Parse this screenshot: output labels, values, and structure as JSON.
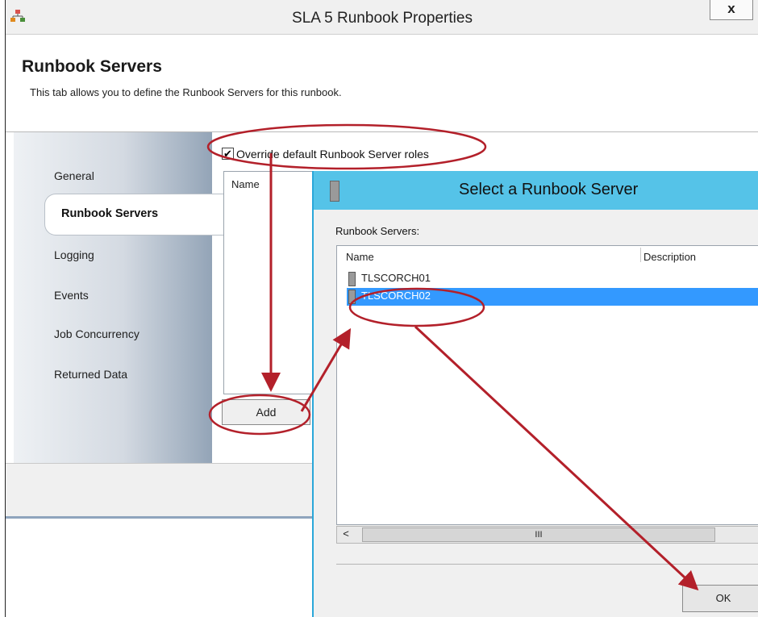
{
  "window": {
    "title": "SLA 5 Runbook Properties",
    "close_label": "x",
    "app_icon": "org-chart-icon"
  },
  "header": {
    "title": "Runbook Servers",
    "subtitle": "This tab allows you to define the Runbook Servers for this runbook."
  },
  "sidebar": {
    "items": [
      {
        "label": "General"
      },
      {
        "label": "Runbook Servers",
        "active": true
      },
      {
        "label": "Logging"
      },
      {
        "label": "Events"
      },
      {
        "label": "Job Concurrency"
      },
      {
        "label": "Returned Data"
      }
    ]
  },
  "main": {
    "override_checkbox": {
      "label": "Override default Runbook Server roles",
      "checked": true,
      "check_glyph": "✔"
    },
    "list": {
      "column_name": "Name"
    },
    "add_label": "Add"
  },
  "dialog": {
    "title": "Select a Runbook Server",
    "list_label": "Runbook Servers:",
    "columns": [
      "Name",
      "Description"
    ],
    "rows": [
      {
        "name": "TLSCORCH01",
        "selected": false
      },
      {
        "name": "TLSCORCH02",
        "selected": true
      }
    ],
    "scroll_left_glyph": "<",
    "scroll_thumb_glyph": "III",
    "ok_label": "OK"
  },
  "colors": {
    "accent": "#55c3e8",
    "selection": "#3399ff",
    "annotation": "#b3202a"
  }
}
